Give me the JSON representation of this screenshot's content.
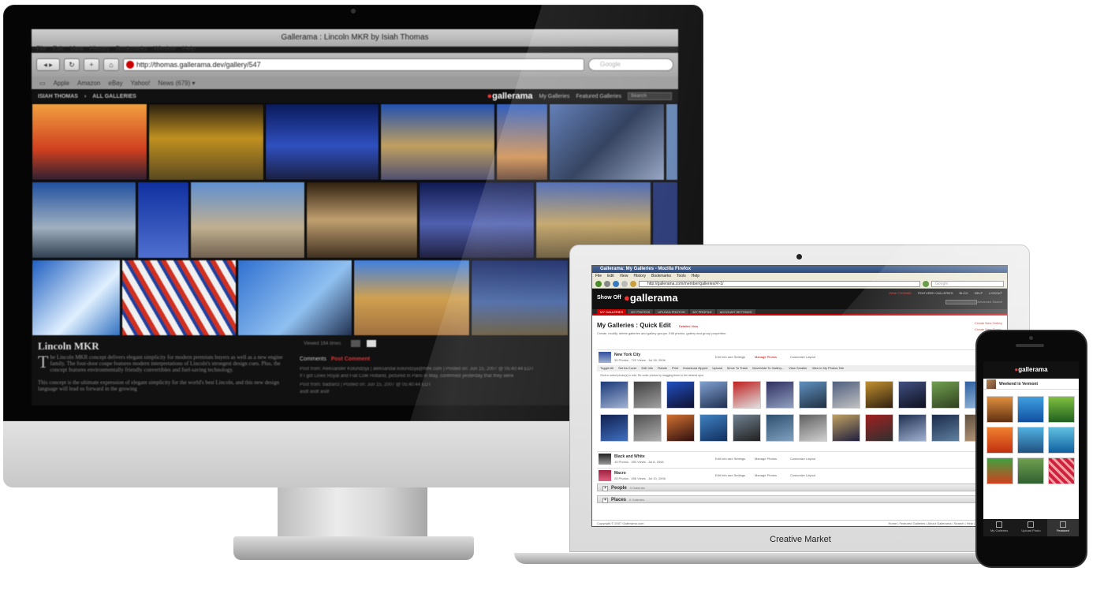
{
  "imac": {
    "window_title": "Gallerama : Lincoln MKR by Isiah Thomas",
    "menu": [
      "File",
      "Edit",
      "View",
      "History",
      "Bookmarks",
      "Window",
      "Help"
    ],
    "url": "http://thomas.gallerama.dev/gallery/547",
    "search_placeholder": "Google",
    "bookmarks": [
      "Apple",
      "Amazon",
      "eBay",
      "Yahoo!",
      "News (679) ▾"
    ],
    "site_nav": [
      "ISIAH THOMAS",
      "ALL GALLERIES"
    ],
    "site_right": [
      "My Galleries",
      "Featured Galleries"
    ],
    "site_search": "Search",
    "logo_text": "gallerama",
    "gallery_title": "Lincoln MKR",
    "description_dropcap": "T",
    "description": "he Lincoln MKR concept delivers elegant simplicity for modern premium buyers as well as a new engine family. The four-door coupe features modern interpretations of Lincoln's strongest design cues. Plus, the concept features environmentally friendly convertibles and fuel-saving technology.",
    "description_2": "This concept is the ultimate expression of elegant simplicity for the world's best Lincoln, and this new design language will lead us forward in the growing",
    "views": "Viewed 164 times",
    "comments_label": "Comments",
    "post_comment": "Post Comment",
    "comment_lines": [
      "Post from: Aleksander Kolundzija | aleksandar.kolundzija@hilfe.com | Posted on: Jun 15, 2007 @ 05:40:44 EDT",
      "If I got Lineo Royal and Fiat Cole Holland, pictured in Paris in May, confirmed yesterday that they were",
      "Post from: badlan3 | Posted on: Jun 15, 2007 @ 05:40:44 EDT",
      "asdf asdf asdf"
    ]
  },
  "laptop": {
    "brand": "Creative Market",
    "window_title": "Gallerama: My Galleries - Mozilla Firefox",
    "menu": [
      "File",
      "Edit",
      "View",
      "History",
      "Bookmarks",
      "Tools",
      "Help"
    ],
    "url": "http://gallerama.com/member/galleries/#/-1/",
    "search_placeholder": "Google",
    "show_off": "Show Off",
    "logo_text": "gallerama",
    "header_links": [
      "FEATURED GALLERIES",
      "BLOG",
      "HELP",
      "LOGOUT"
    ],
    "header_user": "ISIAH THOMAS",
    "advanced_search": "Advanced Search",
    "tabs": [
      "MY GALLERIES",
      "MY PHOTOS",
      "UPLOAD PHOTOS",
      "MY PROFILE",
      "ACCOUNT SETTINGS"
    ],
    "page_title": "My Galleries : Quick Edit",
    "detailed_view": "Detailed View",
    "subtitle": "Create, modify, delete galleries and gallery groups. Edit photos, gallery and group properties.",
    "create_links": [
      "Create New Gallery",
      "Create New Group"
    ],
    "galleries": [
      {
        "name": "New York City",
        "meta": "35 Photos . 722 Views . Jul 18, 2006"
      },
      {
        "name": "Black and White",
        "meta": "15 Photos . 390 Views . Jul 8, 2006"
      },
      {
        "name": "Macro",
        "meta": "28 Photos . 456 Views . Jul 10, 2006"
      }
    ],
    "row_actions": [
      "Edit Info and Settings",
      "Manage Photos",
      "Customize Layout"
    ],
    "email_link": "Email Link",
    "photo_tools": [
      "Toggle All",
      "Set As Cover",
      "Edit Info",
      "Rotate",
      "Print",
      "Download Zipped",
      "Upload",
      "Move To Trash",
      "Move/Add To Gallery...",
      "View Smaller",
      "View in My Photos Tab"
    ],
    "hint": "Click to select photo(s) to edit. Re-order photos by dragging them to the desired spot.",
    "categories": [
      {
        "name": "People",
        "count": "0 Galleries"
      },
      {
        "name": "Places",
        "count": "0 Galleries"
      }
    ],
    "footer_left": "Copyright © 2007 Gallerama.com",
    "footer_right": "Home | Featured Galleries | About Gallerama | Search | Help | Contact Us | Terms"
  },
  "phone": {
    "logo_text": "gallerama",
    "gallery_title": "Weekend in Vermont",
    "tabs": [
      "My Galleries",
      "Upload Photo",
      "Featured"
    ],
    "active_tab": "Featured"
  },
  "colors": {
    "accent": "#cc0000",
    "dark": "#111111"
  }
}
